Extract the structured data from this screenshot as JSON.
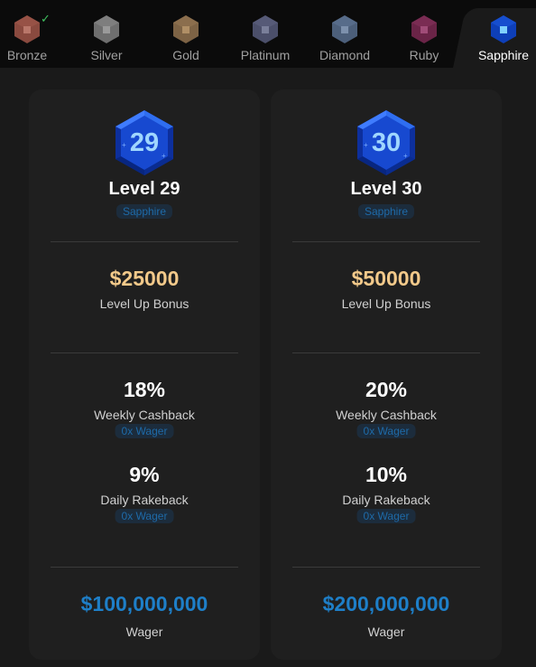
{
  "tabs": [
    {
      "label": "Bronze",
      "color": "#8a4a3f",
      "inner": "#b9776a",
      "completed": true
    },
    {
      "label": "Silver",
      "color": "#6e6e6e",
      "inner": "#9a9a9a"
    },
    {
      "label": "Gold",
      "color": "#7d6345",
      "inner": "#b08f66"
    },
    {
      "label": "Platinum",
      "color": "#4b4f6a",
      "inner": "#7a7f9a"
    },
    {
      "label": "Diamond",
      "color": "#4c5f7a",
      "inner": "#7d91ad"
    },
    {
      "label": "Ruby",
      "color": "#6a2447",
      "inner": "#a04c78"
    },
    {
      "label": "Sapphire",
      "color": "#0e3fb8",
      "inner": "#7fd0ff",
      "active": true
    }
  ],
  "completed_mark": "✓",
  "cards": [
    {
      "level_number": "29",
      "level_title": "Level 29",
      "tier": "Sapphire",
      "bonus_amount": "$25000",
      "bonus_label": "Level Up Bonus",
      "cashback_value": "18%",
      "cashback_label": "Weekly Cashback",
      "cashback_wager": "0x Wager",
      "rakeback_value": "9%",
      "rakeback_label": "Daily Rakeback",
      "rakeback_wager": "0x Wager",
      "wager_amount": "$100,000,000",
      "wager_label": "Wager"
    },
    {
      "level_number": "30",
      "level_title": "Level 30",
      "tier": "Sapphire",
      "bonus_amount": "$50000",
      "bonus_label": "Level Up Bonus",
      "cashback_value": "20%",
      "cashback_label": "Weekly Cashback",
      "cashback_wager": "0x Wager",
      "rakeback_value": "10%",
      "rakeback_label": "Daily Rakeback",
      "rakeback_wager": "0x Wager",
      "wager_amount": "$200,000,000",
      "wager_label": "Wager"
    }
  ],
  "colors": {
    "accent_blue": "#1e7fc8",
    "gold": "#f2c98a",
    "sapphire_gem": "#1a4fd6"
  }
}
